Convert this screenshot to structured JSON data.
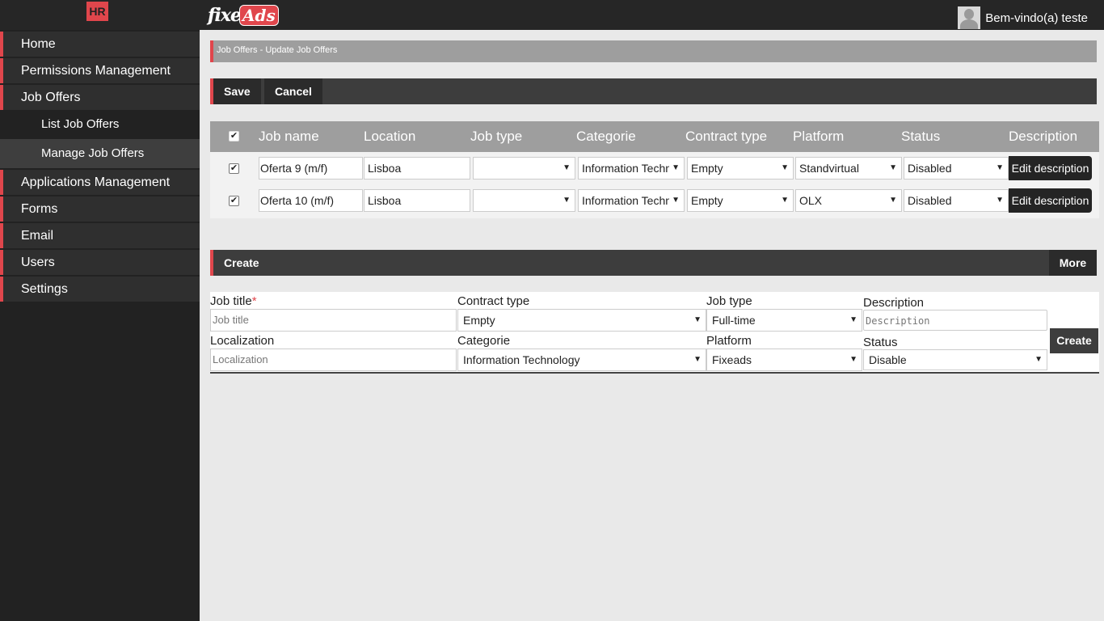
{
  "header": {
    "badge": "HR",
    "logo_part1": "fixe",
    "logo_part2": "Ads",
    "welcome": "Bem-vindo(a) teste"
  },
  "sidebar": {
    "items": [
      {
        "label": "Home"
      },
      {
        "label": "Permissions Management"
      },
      {
        "label": "Job Offers"
      },
      {
        "label": "Applications Management"
      },
      {
        "label": "Forms"
      },
      {
        "label": "Email"
      },
      {
        "label": "Users"
      },
      {
        "label": "Settings"
      }
    ],
    "sub_items": [
      {
        "label": "List Job Offers"
      },
      {
        "label": "Manage Job Offers"
      }
    ]
  },
  "breadcrumb": "Job Offers - Update Job Offers",
  "toolbar": {
    "save": "Save",
    "cancel": "Cancel"
  },
  "table": {
    "columns": [
      "Job name",
      "Location",
      "Job type",
      "Categorie",
      "Contract type",
      "Platform",
      "Status",
      "Description"
    ],
    "rows": [
      {
        "checked": true,
        "job_name": "Oferta 9 (m/f)",
        "location": "Lisboa",
        "job_type": "",
        "categorie": "Information Technology",
        "contract_type": "Empty",
        "platform": "Standvirtual",
        "status": "Disabled",
        "action": "Edit description"
      },
      {
        "checked": true,
        "job_name": "Oferta 10 (m/f)",
        "location": "Lisboa",
        "job_type": "",
        "categorie": "Information Technology",
        "contract_type": "Empty",
        "platform": "OLX",
        "status": "Disabled",
        "action": "Edit description"
      }
    ]
  },
  "create_bar": {
    "create": "Create",
    "more": "More"
  },
  "form": {
    "job_title_label": "Job title",
    "required_mark": "*",
    "job_title_placeholder": "Job title",
    "contract_type_label": "Contract type",
    "contract_type_value": "Empty",
    "job_type_label": "Job type",
    "job_type_value": "Full-time",
    "description_label": "Description",
    "description_placeholder": "Description",
    "localization_label": "Localization",
    "localization_placeholder": "Localization",
    "categorie_label": "Categorie",
    "categorie_value": "Information Technology",
    "platform_label": "Platform",
    "platform_value": "Fixeads",
    "status_label": "Status",
    "status_value": "Disable",
    "create": "Create"
  },
  "colors": {
    "accent": "#e0464c",
    "dark": "#262626",
    "header_gray": "#9e9e9e"
  }
}
